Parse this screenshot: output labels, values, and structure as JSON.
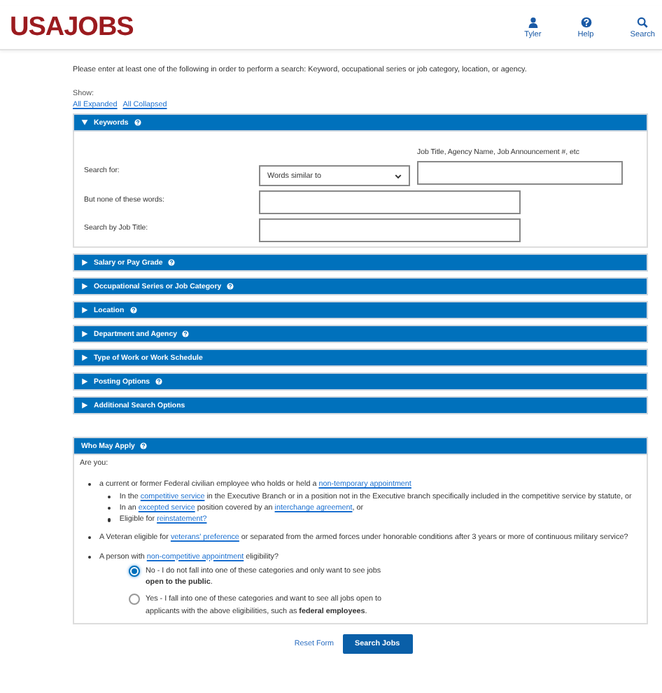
{
  "header": {
    "logo": "USAJOBS",
    "nav": [
      {
        "label": "Tyler"
      },
      {
        "label": "Help"
      },
      {
        "label": "Search"
      }
    ]
  },
  "intro": "Please enter at least one of the following in order to perform a search: Keyword, occupational series or job category, location, or agency.",
  "show": {
    "label": "Show:",
    "links": [
      "All Expanded",
      "All Collapsed"
    ]
  },
  "sections": [
    {
      "title": "Keywords",
      "expanded": true,
      "help": true
    },
    {
      "title": "Salary or Pay Grade",
      "expanded": false,
      "help": true
    },
    {
      "title": "Occupational Series or Job Category",
      "expanded": false,
      "help": true
    },
    {
      "title": "Location",
      "expanded": false,
      "help": true
    },
    {
      "title": "Department and Agency",
      "expanded": false,
      "help": true
    },
    {
      "title": "Type of Work or Work Schedule",
      "expanded": false,
      "help": false
    },
    {
      "title": "Posting Options",
      "expanded": false,
      "help": true
    },
    {
      "title": "Additional Search Options",
      "expanded": false,
      "help": false
    }
  ],
  "keyword_form": {
    "hint": "Job Title, Agency Name, Job Announcement #, etc",
    "rows": [
      {
        "label": "Search for:",
        "select": "Words similar to"
      },
      {
        "label": "But none of these words:"
      },
      {
        "label": "Search by Job Title:"
      }
    ]
  },
  "who_may_apply": {
    "title": "Who May Apply",
    "help": true,
    "prompt": "Are you:",
    "items": [
      {
        "parts": [
          {
            "text": "a current or former Federal civilian employee who holds or held a ",
            "link": false
          },
          {
            "text": "non-temporary appointment",
            "link": true
          }
        ],
        "children": [
          {
            "parts": [
              {
                "text": "In the ",
                "link": false
              },
              {
                "text": "competitive service",
                "link": true
              },
              {
                "text": " in the Executive Branch or in a position not in the Executive branch specifically included in the competitive service by statute, or",
                "link": false
              }
            ]
          },
          {
            "parts": [
              {
                "text": "In an ",
                "link": false
              },
              {
                "text": "excepted service",
                "link": true
              },
              {
                "text": " position covered by an ",
                "link": false
              },
              {
                "text": "interchange agreement",
                "link": true
              },
              {
                "text": ", or",
                "link": false
              }
            ]
          },
          {
            "parts": [
              {
                "text": "Eligible for ",
                "link": false
              },
              {
                "text": "reinstatement?",
                "link": true
              }
            ]
          }
        ]
      },
      {
        "parts": [
          {
            "text": "A Veteran eligible for ",
            "link": false
          },
          {
            "text": "veterans' preference",
            "link": true
          },
          {
            "text": " or separated from the armed forces under honorable conditions after 3 years or more of continuous military service?",
            "link": false
          }
        ]
      },
      {
        "parts": [
          {
            "text": "A person with ",
            "link": false
          },
          {
            "text": "non-competitive appointment",
            "link": true
          },
          {
            "text": " eligibility?",
            "link": false
          }
        ]
      }
    ],
    "options": [
      {
        "text": "No - I do not fall into one of these categories and only want to see jobs **open to the public**.",
        "selected": true
      },
      {
        "text": "Yes - I fall into one of these categories and want to see all jobs open to applicants with the above eligibilities, such as **federal employees**.",
        "selected": false
      }
    ]
  },
  "actions": {
    "reset": "Reset Form",
    "submit": "Search Jobs"
  }
}
